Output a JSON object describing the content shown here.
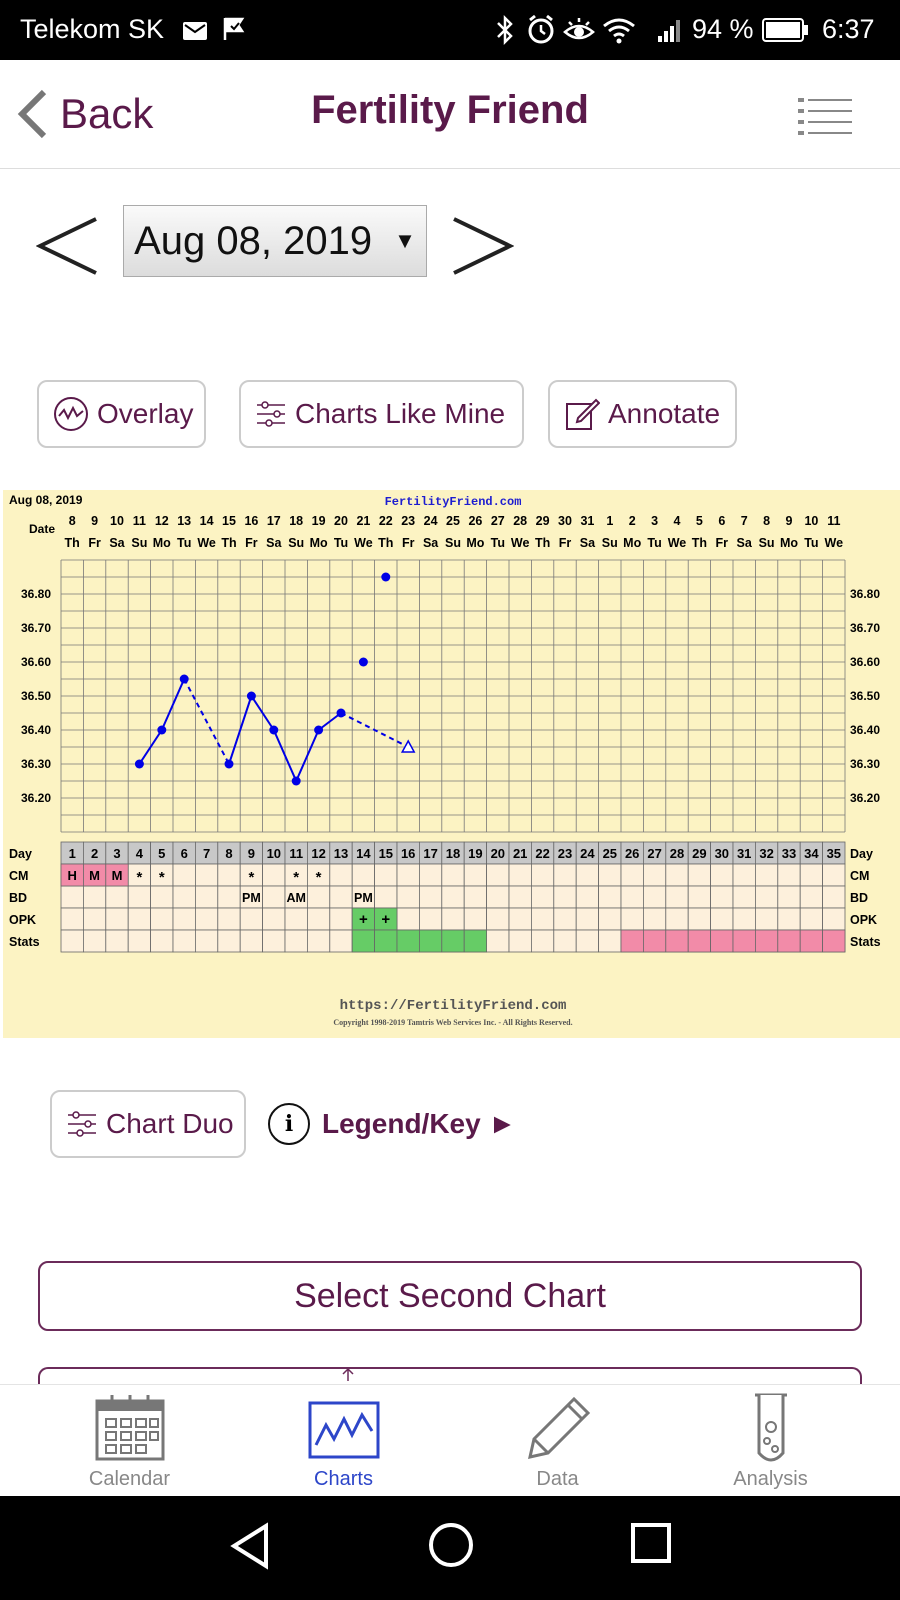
{
  "status": {
    "carrier": "Telekom SK",
    "battery": "94 %",
    "time": "6:37"
  },
  "header": {
    "back_label": "Back",
    "title": "Fertility Friend"
  },
  "date_selector": {
    "value": "Aug 08, 2019",
    "dropdown_glyph": "▼"
  },
  "actions": {
    "overlay": "Overlay",
    "charts_like_mine": "Charts Like Mine",
    "annotate": "Annotate"
  },
  "chart_data": {
    "type": "line",
    "title": "FertilityFriend.com",
    "chart_date": "Aug 08, 2019",
    "row_labels": {
      "date": "Date",
      "day": "Day",
      "cm": "CM",
      "bd": "BD",
      "opk": "OPK",
      "stats": "Stats"
    },
    "dates": [
      "8",
      "9",
      "10",
      "11",
      "12",
      "13",
      "14",
      "15",
      "16",
      "17",
      "18",
      "19",
      "20",
      "21",
      "22",
      "23",
      "24",
      "25",
      "26",
      "27",
      "28",
      "29",
      "30",
      "31",
      "1",
      "2",
      "3",
      "4",
      "5",
      "6",
      "7",
      "8",
      "9",
      "10",
      "11"
    ],
    "weekdays": [
      "Th",
      "Fr",
      "Sa",
      "Su",
      "Mo",
      "Tu",
      "We",
      "Th",
      "Fr",
      "Sa",
      "Su",
      "Mo",
      "Tu",
      "We",
      "Th",
      "Fr",
      "Sa",
      "Su",
      "Mo",
      "Tu",
      "We",
      "Th",
      "Fr",
      "Sa",
      "Su",
      "Mo",
      "Tu",
      "We",
      "Th",
      "Fr",
      "Sa",
      "Su",
      "Mo",
      "Tu",
      "We"
    ],
    "days": [
      1,
      2,
      3,
      4,
      5,
      6,
      7,
      8,
      9,
      10,
      11,
      12,
      13,
      14,
      15,
      16,
      17,
      18,
      19,
      20,
      21,
      22,
      23,
      24,
      25,
      26,
      27,
      28,
      29,
      30,
      31,
      32,
      33,
      34,
      35
    ],
    "y_ticks": [
      "36.80",
      "36.70",
      "36.60",
      "36.50",
      "36.40",
      "36.30",
      "36.20"
    ],
    "ylim": [
      36.1,
      36.9
    ],
    "temperatures": [
      {
        "day": 4,
        "temp": 36.3,
        "type": "point"
      },
      {
        "day": 5,
        "temp": 36.4,
        "type": "point"
      },
      {
        "day": 6,
        "temp": 36.55,
        "type": "point"
      },
      {
        "day": 8,
        "temp": 36.3,
        "type": "point"
      },
      {
        "day": 9,
        "temp": 36.5,
        "type": "point"
      },
      {
        "day": 10,
        "temp": 36.4,
        "type": "point"
      },
      {
        "day": 11,
        "temp": 36.25,
        "type": "point"
      },
      {
        "day": 12,
        "temp": 36.4,
        "type": "point"
      },
      {
        "day": 13,
        "temp": 36.45,
        "type": "point"
      },
      {
        "day": 14,
        "temp": 36.6,
        "type": "point"
      },
      {
        "day": 15,
        "temp": 36.85,
        "type": "point"
      },
      {
        "day": 16,
        "temp": 36.35,
        "type": "discarded"
      }
    ],
    "segments": [
      {
        "from": 4,
        "to": 5,
        "style": "solid"
      },
      {
        "from": 5,
        "to": 6,
        "style": "solid"
      },
      {
        "from": 6,
        "to": 8,
        "style": "dashed"
      },
      {
        "from": 8,
        "to": 9,
        "style": "solid"
      },
      {
        "from": 9,
        "to": 10,
        "style": "solid"
      },
      {
        "from": 10,
        "to": 11,
        "style": "solid"
      },
      {
        "from": 11,
        "to": 12,
        "style": "solid"
      },
      {
        "from": 12,
        "to": 13,
        "style": "solid"
      },
      {
        "from": 13,
        "to": 16,
        "style": "dashed"
      }
    ],
    "cm": [
      {
        "day": 1,
        "label": "H"
      },
      {
        "day": 2,
        "label": "M"
      },
      {
        "day": 3,
        "label": "M"
      },
      {
        "day": 4,
        "label": "*"
      },
      {
        "day": 5,
        "label": "*"
      },
      {
        "day": 9,
        "label": "*"
      },
      {
        "day": 11,
        "label": "*"
      },
      {
        "day": 12,
        "label": "*"
      }
    ],
    "bd": [
      {
        "day": 9,
        "label": "PM"
      },
      {
        "day": 11,
        "label": "AM"
      },
      {
        "day": 14,
        "label": "PM"
      }
    ],
    "opk": [
      {
        "day": 14,
        "label": "+"
      },
      {
        "day": 15,
        "label": "+"
      }
    ],
    "stats_green_days": [
      14,
      15,
      16,
      17,
      18,
      19
    ],
    "stats_pink_days": [
      26,
      27,
      28,
      29,
      30,
      31,
      32,
      33,
      34,
      35
    ],
    "footer_url": "https://FertilityFriend.com",
    "copyright": "Copyright 1998-2019 Tamtris Web Services Inc. - All Rights Reserved."
  },
  "colors": {
    "accent": "#5a1a4a",
    "line": "#0000e6",
    "chart_bg": "#fcf3c3",
    "pink": "#f28ba8",
    "green": "#66cc66",
    "active_tab": "#2d46c9"
  },
  "lower": {
    "chart_duo": "Chart Duo",
    "legend_key": "Legend/Key ►",
    "select_second_chart": "Select Second Chart"
  },
  "tabs": [
    {
      "label": "Calendar",
      "icon": "calendar-icon"
    },
    {
      "label": "Charts",
      "icon": "chart-icon",
      "active": true
    },
    {
      "label": "Data",
      "icon": "pencil-icon"
    },
    {
      "label": "Analysis",
      "icon": "test-tube-icon"
    }
  ]
}
